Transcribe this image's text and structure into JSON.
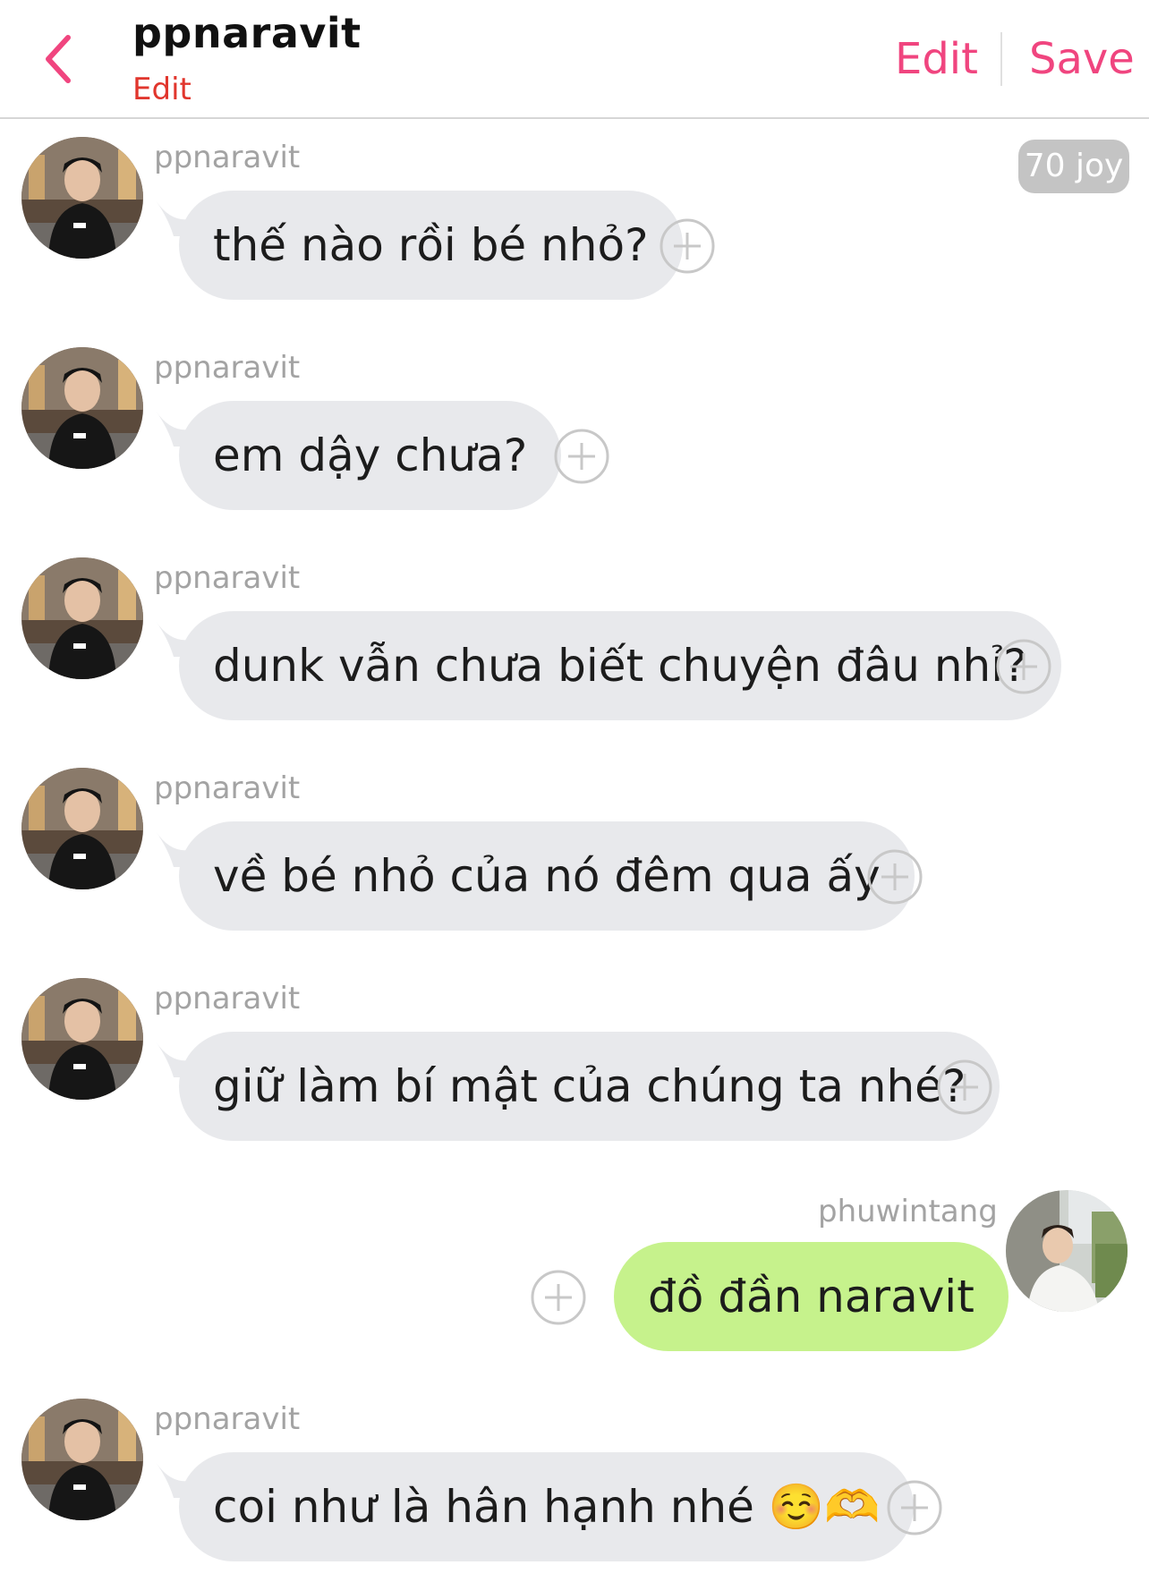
{
  "header": {
    "title": "ppnaravit",
    "subtitle": "Edit",
    "edit_label": "Edit",
    "save_label": "Save",
    "accent_color": "#f0457f",
    "subtitle_color": "#e1362d"
  },
  "joy_badge": "70 joy",
  "messages": [
    {
      "sender": "ppnaravit",
      "text": "thế nào rồi bé nhỏ?",
      "side": "left"
    },
    {
      "sender": "ppnaravit",
      "text": "em dậy chưa?",
      "side": "left"
    },
    {
      "sender": "ppnaravit",
      "text": "dunk vẫn chưa biết chuyện đâu nhỉ?",
      "side": "left"
    },
    {
      "sender": "ppnaravit",
      "text": "về bé nhỏ của nó đêm qua ấy",
      "side": "left"
    },
    {
      "sender": "ppnaravit",
      "text": "giữ làm bí mật của chúng ta nhé?",
      "side": "left"
    },
    {
      "sender": "phuwintang",
      "text": "đồ đần naravit",
      "side": "right"
    },
    {
      "sender": "ppnaravit",
      "text": "coi như là hân hạnh nhé",
      "emoji": "☺️🫶",
      "side": "left"
    }
  ],
  "colors": {
    "incoming_bubble": "#e8e9ec",
    "outgoing_bubble": "#c6f28c",
    "sender_name": "#a3a3a3"
  },
  "icons": {
    "back": "chevron-left-icon",
    "add": "plus-circle-icon",
    "avatar": "user-avatar"
  }
}
